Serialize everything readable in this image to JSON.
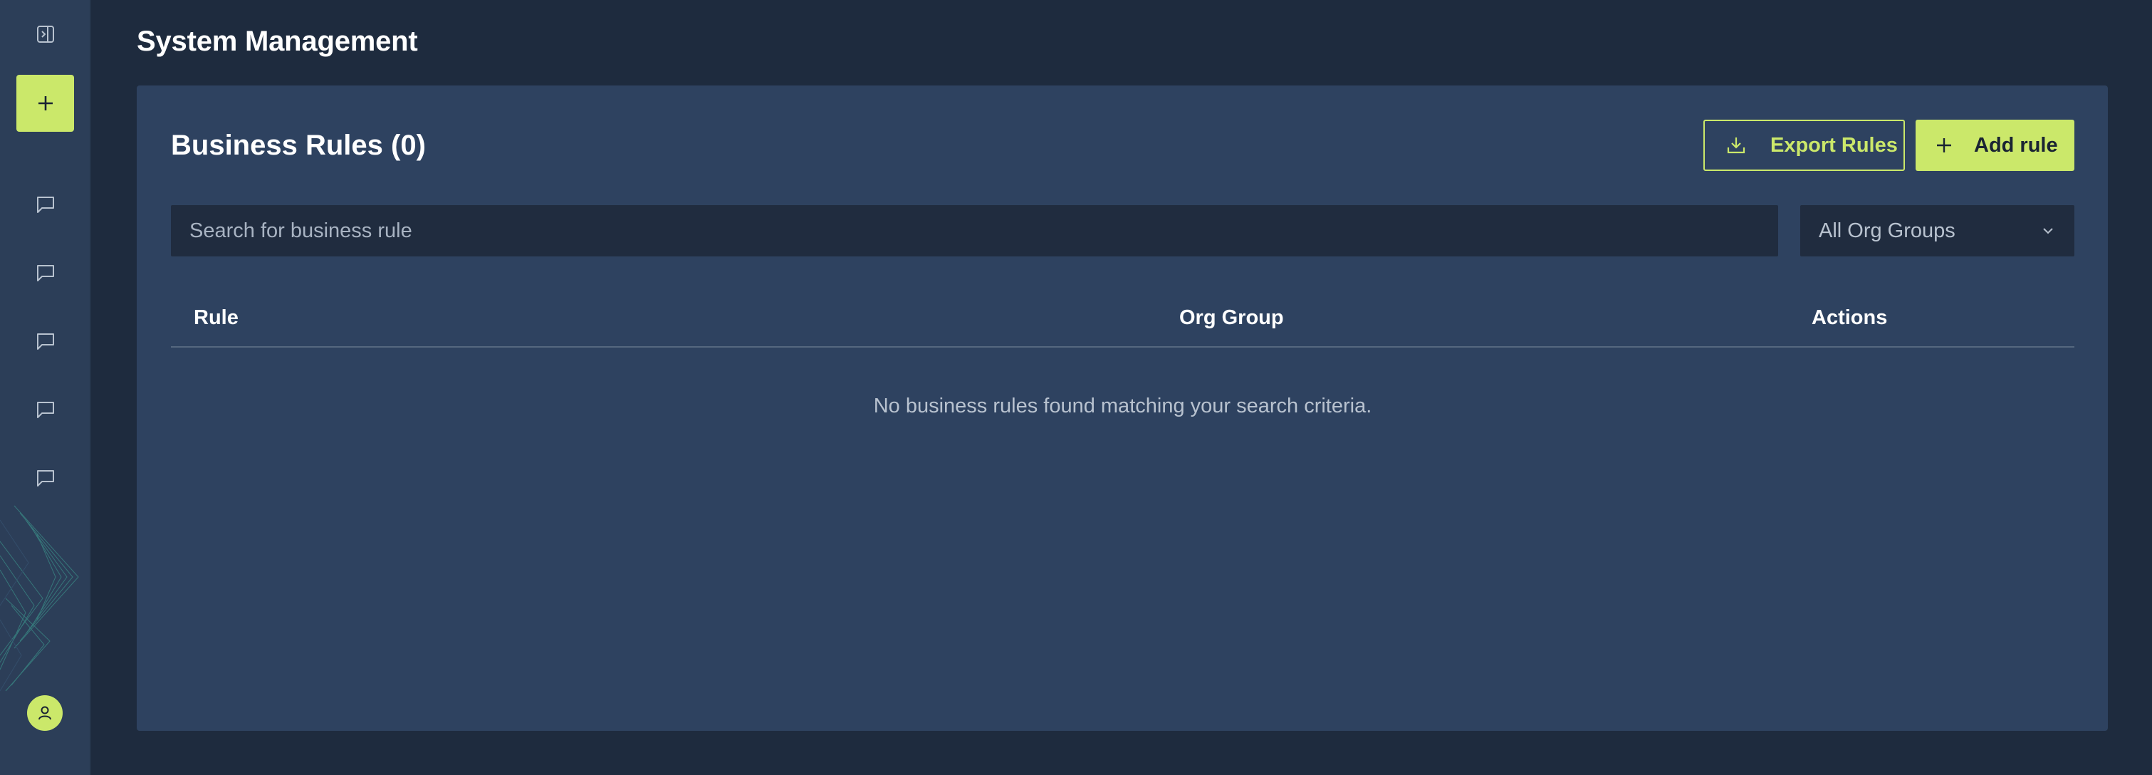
{
  "page": {
    "title": "System Management"
  },
  "sidebar": {
    "toggle_icon": "panel-expand-icon",
    "new_icon": "plus-icon",
    "chat_items": [
      {
        "icon": "chat-bubble-icon"
      },
      {
        "icon": "chat-bubble-icon"
      },
      {
        "icon": "chat-bubble-icon"
      },
      {
        "icon": "chat-bubble-icon"
      },
      {
        "icon": "chat-bubble-icon"
      }
    ],
    "avatar_icon": "user-icon"
  },
  "card": {
    "title": "Business Rules (0)",
    "export_label": "Export Rules",
    "add_label": "Add rule",
    "search_placeholder": "Search for business rule",
    "search_value": "",
    "org_filter": "All Org Groups"
  },
  "table": {
    "columns": [
      "Rule",
      "Org Group",
      "Actions"
    ],
    "rows": [],
    "empty_message": "No business rules found matching your search criteria."
  },
  "colors": {
    "accent": "#cbe86a",
    "background": "#1e2b3e",
    "sidebar": "#2c3e58",
    "card": "#2e4260",
    "input": "#202c3f"
  }
}
